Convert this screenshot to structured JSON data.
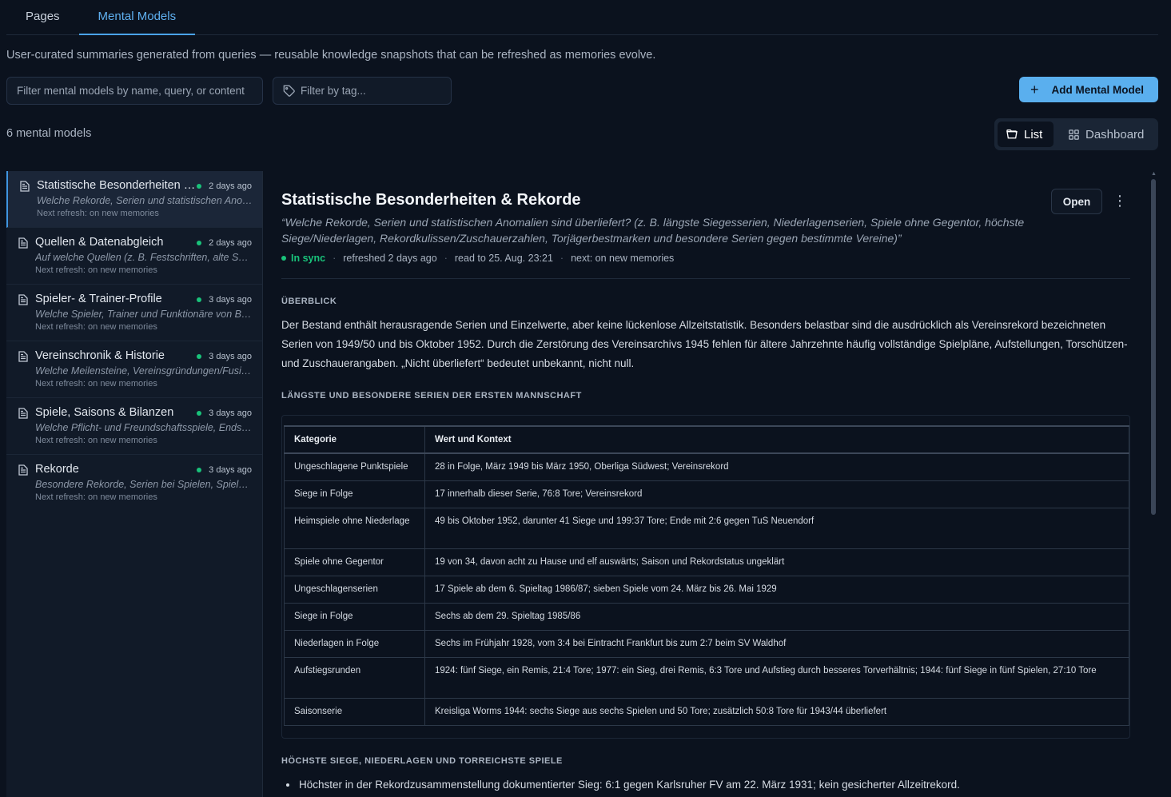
{
  "tabs": [
    {
      "label": "Pages"
    },
    {
      "label": "Mental Models"
    }
  ],
  "description": "User-curated summaries generated from queries — reusable knowledge snapshots that can be refreshed as memories evolve.",
  "filters": {
    "name_placeholder": "Filter mental models by name, query, or content",
    "tag_placeholder": "Filter by tag..."
  },
  "add_button_label": "Add Mental Model",
  "count_label": "6 mental models",
  "view_toggle": {
    "list": "List",
    "dashboard": "Dashboard"
  },
  "models": [
    {
      "title": "Statistische Besonderheiten & Rekorde",
      "time": "2 days ago",
      "query": "Welche Rekorde, Serien und statistischen Anomalien sind überliefert?",
      "next": "Next refresh: on new memories"
    },
    {
      "title": "Quellen & Datenabgleich",
      "time": "2 days ago",
      "query": "Auf welche Quellen (z. B. Festschriften, alte Spielberichte) stützt sich der Bestand?",
      "next": "Next refresh: on new memories"
    },
    {
      "title": "Spieler- & Trainer-Profile",
      "time": "3 days ago",
      "query": "Welche Spieler, Trainer und Funktionäre von Bedeutung sind bekannt?",
      "next": "Next refresh: on new memories"
    },
    {
      "title": "Vereinschronik & Historie",
      "time": "3 days ago",
      "query": "Welche Meilensteine, Vereinsgründungen/Fusionen sind überliefert?",
      "next": "Next refresh: on new memories"
    },
    {
      "title": "Spiele, Saisons & Bilanzen",
      "time": "3 days ago",
      "query": "Welche Pflicht- und Freundschaftsspiele, Endstände und Bilanzen sind bekannt?",
      "next": "Next refresh: on new memories"
    },
    {
      "title": "Rekorde",
      "time": "3 days ago",
      "query": "Besondere Rekorde, Serien bei Spielen, Spielern und Zuschauern",
      "next": "Next refresh: on new memories"
    }
  ],
  "detail": {
    "title": "Statistische Besonderheiten & Rekorde",
    "query": "“Welche Rekorde, Serien und statistischen Anomalien sind überliefert? (z. B. längste Siegesserien, Niederlagenserien, Spiele ohne Gegentor, höchste Siege/Niederlagen, Rekordkulissen/Zuschauerzahlen, Torjägerbestmarken und besondere Serien gegen bestimmte Vereine)”",
    "open_label": "Open",
    "status": "In sync",
    "refreshed": "refreshed 2 days ago",
    "read_to": "read to 25. Aug. 23:21",
    "next": "next: on new memories",
    "section1_heading": "ÜBERBLICK",
    "section1_text": "Der Bestand enthält herausragende Serien und Einzelwerte, aber keine lückenlose Allzeitstatistik. Besonders belastbar sind die ausdrücklich als Vereinsrekord bezeichneten Serien von 1949/50 und bis Oktober 1952. Durch die Zerstörung des Vereinsarchivs 1945 fehlen für ältere Jahrzehnte häufig vollständige Spielpläne, Aufstellungen, Torschützen- und Zuschauerangaben. „Nicht überliefert“ bedeutet unbekannt, nicht null.",
    "section2_heading": "LÄNGSTE UND BESONDERE SERIEN DER ERSTEN MANNSCHAFT",
    "table_headers": [
      "Kategorie",
      "Wert und Kontext"
    ],
    "table_rows": [
      [
        "Ungeschlagene Punktspiele",
        "28 in Folge, März 1949 bis März 1950, Oberliga Südwest; Vereinsrekord"
      ],
      [
        "Siege in Folge",
        "17 innerhalb dieser Serie, 76:8 Tore; Vereinsrekord"
      ],
      [
        "Heimspiele ohne Niederlage",
        "49 bis Oktober 1952, darunter 41 Siege und 199:37 Tore; Ende mit 2:6 gegen TuS Neuendorf"
      ],
      [
        "Spiele ohne Gegentor",
        "19 von 34, davon acht zu Hause und elf auswärts; Saison und Rekordstatus ungeklärt"
      ],
      [
        "Ungeschlagenserien",
        "17 Spiele ab dem 6. Spieltag 1986/87; sieben Spiele vom 24. März bis 26. Mai 1929"
      ],
      [
        "Siege in Folge",
        "Sechs ab dem 29. Spieltag 1985/86"
      ],
      [
        "Niederlagen in Folge",
        "Sechs im Frühjahr 1928, vom 3:4 bei Eintracht Frankfurt bis zum 2:7 beim SV Waldhof"
      ],
      [
        "Aufstiegsrunden",
        "1924: fünf Siege, ein Remis, 21:4 Tore; 1977: ein Sieg, drei Remis, 6:3 Tore und Aufstieg durch besseres Torverhältnis; 1944: fünf Siege in fünf Spielen, 27:10 Tore"
      ],
      [
        "Saisonserie",
        "Kreisliga Worms 1944: sechs Siege aus sechs Spielen und 50 Tore; zusätzlich 50:8 Tore für 1943/44 überliefert"
      ]
    ],
    "section3_heading": "HÖCHSTE SIEGE, NIEDERLAGEN UND TORREICHSTE SPIELE",
    "bullet1": "Höchster in der Rekordzusammenstellung dokumentierter Sieg: 6:1 gegen Karlsruher FV am 22. März 1931; kein gesicherter Allzeitrekord."
  },
  "colors": {
    "accent": "#5aafee",
    "sync": "#19c27a",
    "background": "#0b121e"
  }
}
